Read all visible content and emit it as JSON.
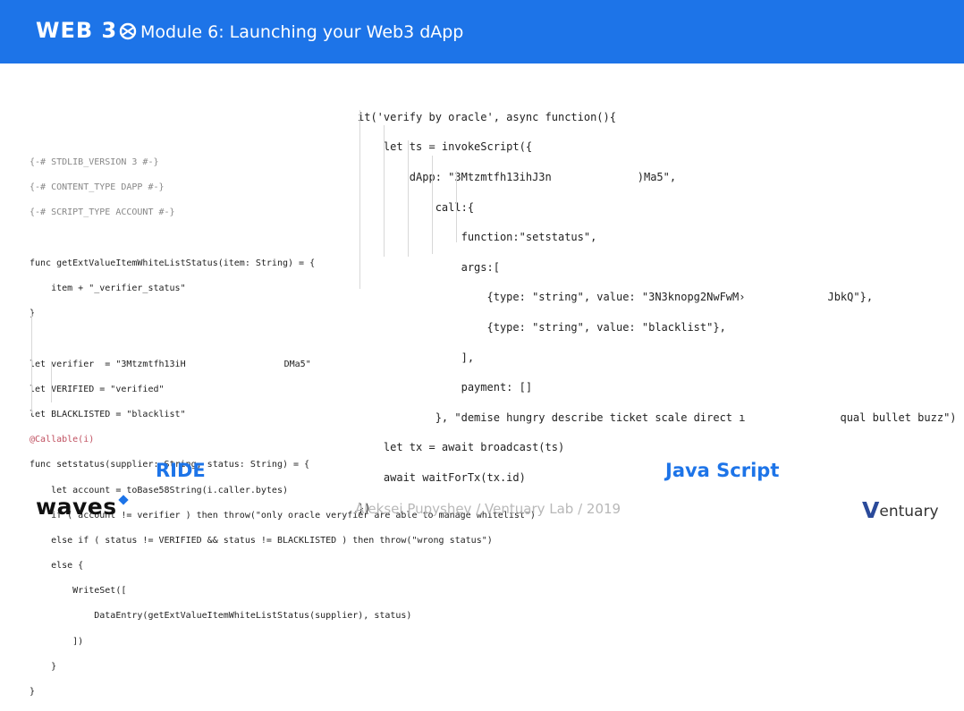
{
  "header": {
    "logo": "WEB 3",
    "title": "Module 6: Launching your Web3 dApp"
  },
  "ride_code": [
    "{-# STDLIB_VERSION 3 #-}",
    "{-# CONTENT_TYPE DAPP #-}",
    "{-# SCRIPT_TYPE ACCOUNT #-}",
    "",
    "func getExtValueItemWhiteListStatus(item: String) = {",
    "    item + \"_verifier_status\"",
    "}",
    "",
    "let verifier  = \"3Mtzmtfh13iH",
    "DMa5\"",
    "let VERIFIED = \"verified\"",
    "let BLACKLISTED = \"blacklist\"",
    "@Callable(i)",
    "func setstatus(supplier: String, status: String) = {",
    "    let account = toBase58String(i.caller.bytes)",
    "    if ( account != verifier ) then throw(\"only oracle veryfier are able to manage whitelist\")",
    "    else if ( status != VERIFIED && status != BLACKLISTED ) then throw(\"wrong status\")",
    "    else {",
    "        WriteSet([",
    "            DataEntry(getExtValueItemWhiteListStatus(supplier), status)",
    "        ])",
    "    }",
    "}"
  ],
  "js_code": [
    "it('verify by oracle', async function(){",
    "    let ts = invokeScript({",
    "        dApp: \"3Mtzmtfh13ihJ3n",
    ")Ma5\",",
    "            call:{",
    "                function:\"setstatus\",",
    "                args:[",
    "                    {type: \"string\", value: \"3N3knopg2NwFwM›",
    "JbkQ\"},",
    "                    {type: \"string\", value: \"blacklist\"},",
    "                ],",
    "                payment: []",
    "            }, \"demise hungry describe ticket scale direct ı",
    "qual bullet buzz\")",
    "    let tx = await broadcast(ts)",
    "    await waitForTx(tx.id)",
    "})"
  ],
  "labels": {
    "ride": "RIDE",
    "js": "Java Script"
  },
  "footer": {
    "author": "Aleksei Pupyshev / Ventuary Lab / 2019",
    "waves_logo": "waves",
    "ventuary_logo_v": "V",
    "ventuary_logo_rest": "entuary"
  },
  "colors": {
    "brand_blue": "#1d74e8",
    "string": "#a31515",
    "keyword": "#1a5ad6"
  }
}
